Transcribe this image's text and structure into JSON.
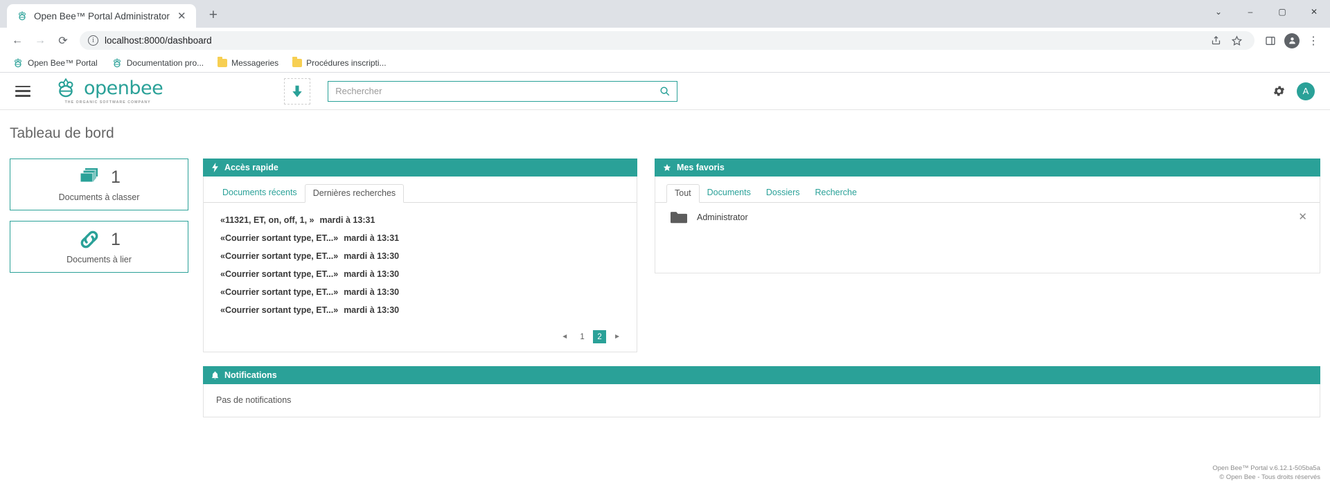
{
  "browser": {
    "tab": {
      "title": "Open Bee™ Portal Administrator",
      "favicon": "bee-icon",
      "close": "✕"
    },
    "new_tab": "+",
    "window_controls": {
      "minimize_chrome": "⌄",
      "minimize": "–",
      "maximize": "▢",
      "close": "✕"
    },
    "nav": {
      "back": "←",
      "forward": "→",
      "reload": "⟳"
    },
    "omnibox": {
      "info_icon": "ⓘ",
      "url": "localhost:8000/dashboard",
      "share": "share-icon",
      "star": "☆",
      "panel": "side-panel-icon",
      "profile": "profile-icon",
      "menu": "⋮"
    },
    "bookmarks": [
      {
        "label": "Open Bee™ Portal",
        "icon": "bee-icon"
      },
      {
        "label": "Documentation pro...",
        "icon": "bee-icon"
      },
      {
        "label": "Messageries",
        "icon": "folder-icon"
      },
      {
        "label": "Procédures inscripti...",
        "icon": "folder-icon"
      }
    ]
  },
  "app": {
    "menu_icon": "hamburger-icon",
    "logo": {
      "wordmark": "openbee",
      "tagline": "THE ORGANIC SOFTWARE COMPANY"
    },
    "download_icon": "download-icon",
    "search": {
      "placeholder": "Rechercher",
      "value": "",
      "icon": "search-icon"
    },
    "settings_icon": "gear-icon",
    "avatar": "A"
  },
  "page": {
    "title": "Tableau de bord",
    "stats": [
      {
        "icon": "documents-stack-icon",
        "count": "1",
        "label": "Documents à classer"
      },
      {
        "icon": "link-icon",
        "count": "1",
        "label": "Documents à lier"
      }
    ],
    "quick_access": {
      "icon": "lightning-icon",
      "title": "Accès rapide",
      "tabs": [
        {
          "label": "Documents récents",
          "active": false
        },
        {
          "label": "Dernières recherches",
          "active": true
        }
      ],
      "searches": [
        {
          "query": "«11321, ET, on, off, 1, »",
          "time": "mardi à 13:31"
        },
        {
          "query": "«Courrier sortant type, ET...»",
          "time": "mardi à 13:31"
        },
        {
          "query": "«Courrier sortant type, ET...»",
          "time": "mardi à 13:30"
        },
        {
          "query": "«Courrier sortant type, ET...»",
          "time": "mardi à 13:30"
        },
        {
          "query": "«Courrier sortant type, ET...»",
          "time": "mardi à 13:30"
        },
        {
          "query": "«Courrier sortant type, ET...»",
          "time": "mardi à 13:30"
        }
      ],
      "pagination": {
        "prev": "◄",
        "pages": [
          "1",
          "2"
        ],
        "current": "2",
        "next": "►"
      }
    },
    "favorites": {
      "icon": "star-icon",
      "title": "Mes favoris",
      "tabs": [
        {
          "label": "Tout",
          "active": true
        },
        {
          "label": "Documents",
          "active": false
        },
        {
          "label": "Dossiers",
          "active": false
        },
        {
          "label": "Recherche",
          "active": false
        }
      ],
      "items": [
        {
          "icon": "folder-icon",
          "name": "Administrator",
          "remove": "✕"
        }
      ]
    },
    "notifications": {
      "icon": "bell-icon",
      "title": "Notifications",
      "empty_text": "Pas de notifications"
    },
    "footer": {
      "line1": "Open Bee™ Portal v.6.12.1-505ba5a",
      "line2": "© Open Bee - Tous droits réservés"
    }
  },
  "colors": {
    "accent": "#2aa198",
    "folder": "#f7cf52"
  }
}
